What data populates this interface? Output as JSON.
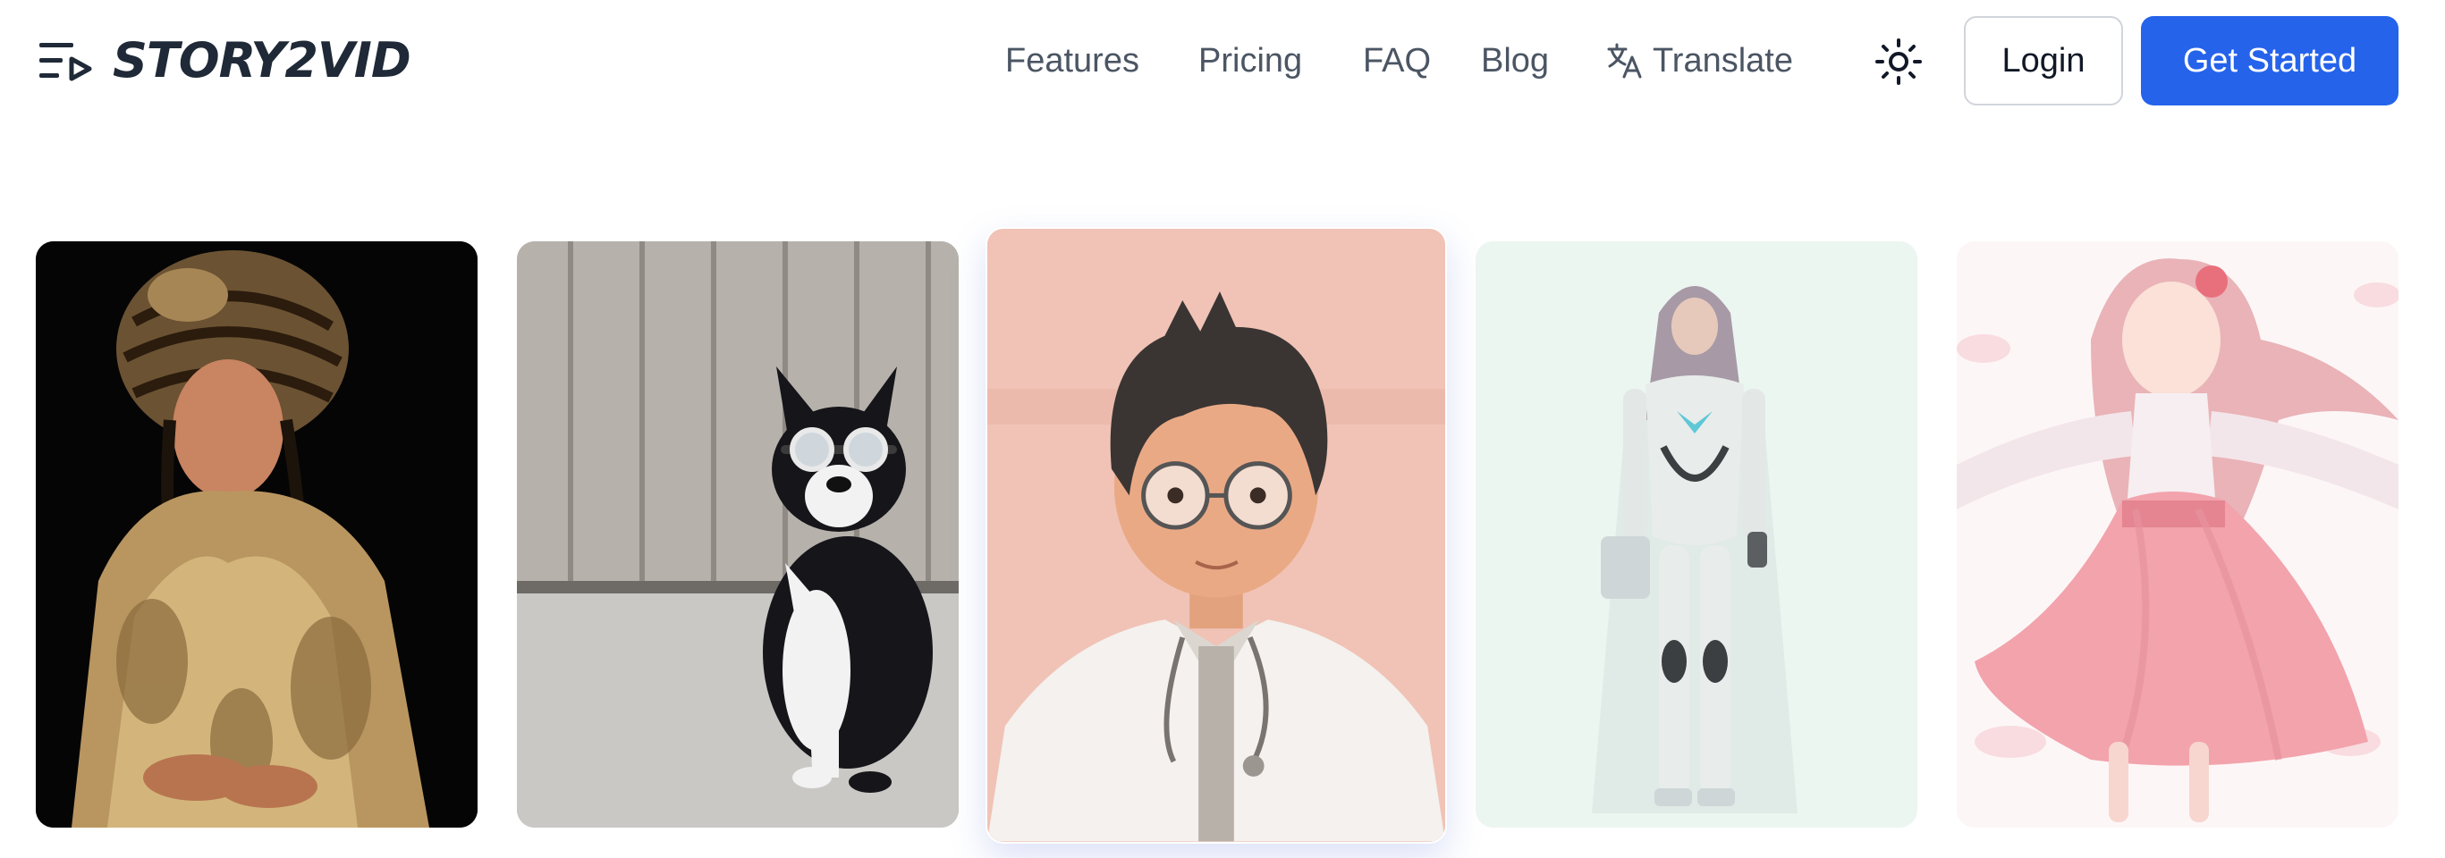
{
  "header": {
    "menu_icon": "menu-play-icon",
    "logo_text": "STORY2VID",
    "nav": {
      "features": "Features",
      "pricing": "Pricing",
      "faq": "FAQ",
      "blog": "Blog",
      "translate": "Translate"
    },
    "translate_icon": "translate-icon",
    "theme_icon": "sun-icon",
    "login_label": "Login",
    "cta_label": "Get Started"
  },
  "colors": {
    "accent": "#2563eb",
    "nav_text": "#4b5563",
    "logo": "#1f2937"
  },
  "gallery": {
    "cards": [
      {
        "name": "fur-coat-portrait-card"
      },
      {
        "name": "dog-goggles-card"
      },
      {
        "name": "cartoon-doctor-card"
      },
      {
        "name": "robot-woman-card"
      },
      {
        "name": "anime-dancer-card"
      }
    ]
  }
}
